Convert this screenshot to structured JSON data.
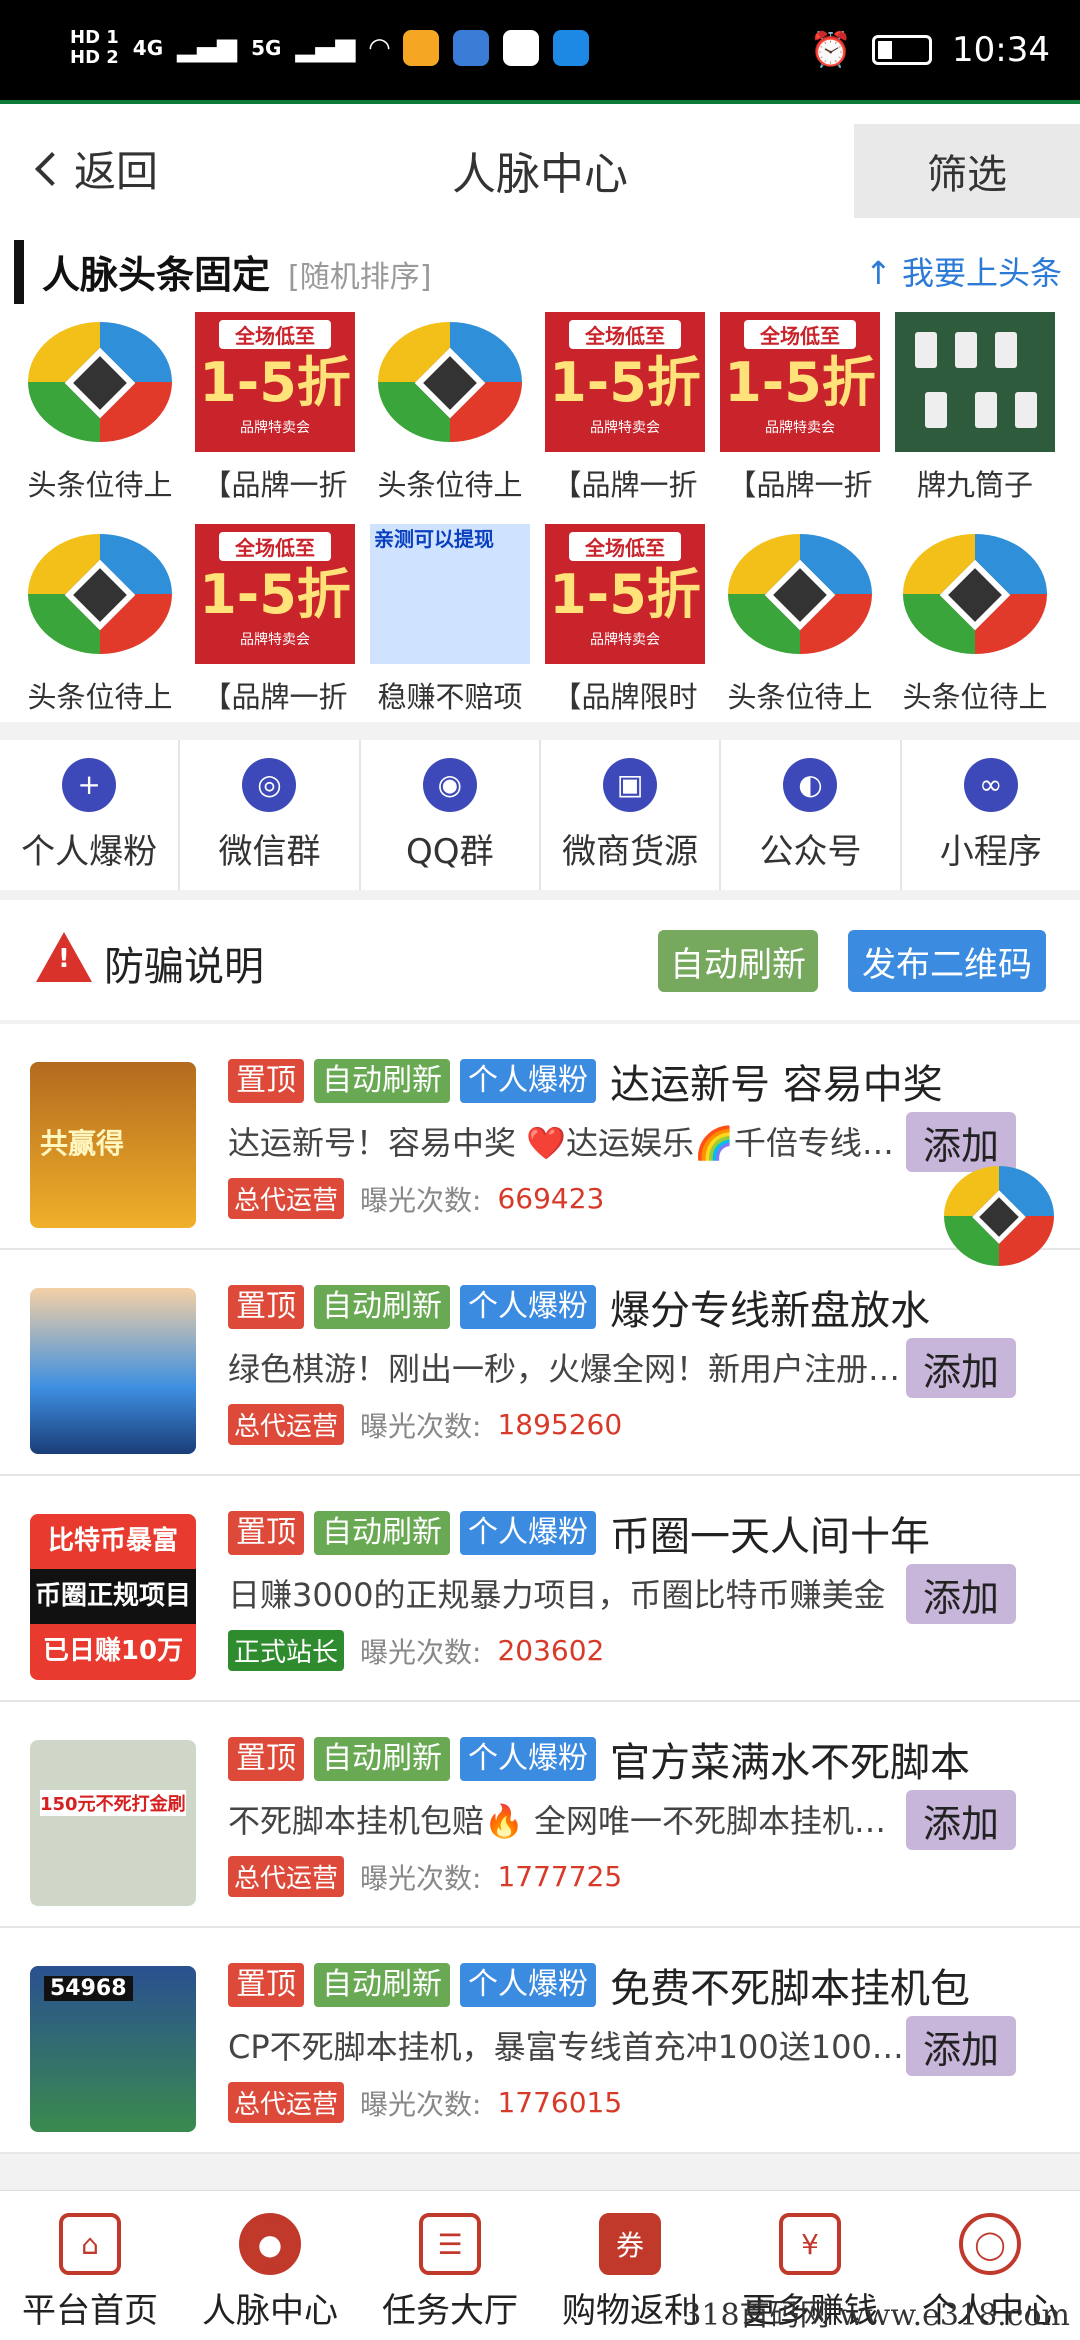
{
  "status_bar": {
    "time": "10:34",
    "hd1": "HD 1",
    "hd2": "HD 2",
    "net1": "4G",
    "net2": "5G"
  },
  "header": {
    "back_label": "返回",
    "title": "人脉中心",
    "filter_label": "筛选"
  },
  "headline": {
    "title": "人脉头条固定",
    "subtitle": "[随机排序]",
    "link": "↑ 我要上头条",
    "sale_text_top": "全场低至",
    "sale_text_big": "1-5折",
    "sale_text_bottom": "品牌特卖会",
    "text_ad_line": "亲测可以提现",
    "items": [
      {
        "label": "头条位待上",
        "thumb": "logo"
      },
      {
        "label": "【品牌一折",
        "thumb": "sale"
      },
      {
        "label": "头条位待上",
        "thumb": "logo"
      },
      {
        "label": "【品牌一折",
        "thumb": "sale"
      },
      {
        "label": "【品牌一折",
        "thumb": "sale"
      },
      {
        "label": "牌九筒子",
        "thumb": "game"
      },
      {
        "label": "头条位待上",
        "thumb": "logo"
      },
      {
        "label": "【品牌一折",
        "thumb": "sale"
      },
      {
        "label": "稳赚不赔项",
        "thumb": "text"
      },
      {
        "label": "【品牌限时",
        "thumb": "sale"
      },
      {
        "label": "头条位待上",
        "thumb": "logo"
      },
      {
        "label": "头条位待上",
        "thumb": "logo"
      }
    ]
  },
  "categories": [
    {
      "label": "个人爆粉",
      "icon": "user-add-icon"
    },
    {
      "label": "微信群",
      "icon": "wechat-icon"
    },
    {
      "label": "QQ群",
      "icon": "qq-icon"
    },
    {
      "label": "微商货源",
      "icon": "cart-icon"
    },
    {
      "label": "公众号",
      "icon": "official-account-icon"
    },
    {
      "label": "小程序",
      "icon": "mini-program-icon"
    }
  ],
  "notice": {
    "label": "防骗说明",
    "auto_refresh": "自动刷新",
    "publish_qr": "发布二维码"
  },
  "listings": [
    {
      "tag_top": "置顶",
      "tag_auto": "自动刷新",
      "tag_cat": "个人爆粉",
      "title": "达运新号 容易中奖",
      "desc": "达运新号！容易中奖 ❤️达运娱乐🌈千倍专线…",
      "badge": "总代运营",
      "badge_color": "red",
      "views_label": "曝光次数:",
      "views": "669423",
      "add": "添加",
      "thumb_text": "共赢得"
    },
    {
      "tag_top": "置顶",
      "tag_auto": "自动刷新",
      "tag_cat": "个人爆粉",
      "title": "爆分专线新盘放水",
      "desc": "绿色棋游！刚出一秒，火爆全网！新用户注册…",
      "badge": "总代运营",
      "badge_color": "red",
      "views_label": "曝光次数:",
      "views": "1895260",
      "add": "添加",
      "thumb_text": ""
    },
    {
      "tag_top": "置顶",
      "tag_auto": "自动刷新",
      "tag_cat": "个人爆粉",
      "title": "币圈一天人间十年",
      "desc": "日赚3000的正规暴力项目，币圈比特币赚美金",
      "badge": "正式站长",
      "badge_color": "green",
      "views_label": "曝光次数:",
      "views": "203602",
      "add": "添加",
      "thumb_lines": [
        "比特币暴富",
        "币圈正规项目",
        "已日赚10万"
      ]
    },
    {
      "tag_top": "置顶",
      "tag_auto": "自动刷新",
      "tag_cat": "个人爆粉",
      "title": "官方菜满水不死脚本",
      "desc": "不死脚本挂机包赔🔥 全网唯一不死脚本挂机…",
      "badge": "总代运营",
      "badge_color": "red",
      "views_label": "曝光次数:",
      "views": "1777725",
      "add": "添加",
      "thumb_text": "150元不死打金刷"
    },
    {
      "tag_top": "置顶",
      "tag_auto": "自动刷新",
      "tag_cat": "个人爆粉",
      "title": "免费不死脚本挂机包",
      "desc": "CP不死脚本挂机，暴富专线首充冲100送100…",
      "badge": "总代运营",
      "badge_color": "red",
      "views_label": "曝光次数:",
      "views": "1776015",
      "add": "添加",
      "thumb_text": "54968"
    }
  ],
  "bottom_nav": [
    {
      "label": "平台首页",
      "icon": "home-icon"
    },
    {
      "label": "人脉中心",
      "icon": "people-icon"
    },
    {
      "label": "任务大厅",
      "icon": "task-icon"
    },
    {
      "label": "购物返利",
      "icon": "shopping-cart-icon"
    },
    {
      "label": "更多赚钱",
      "icon": "wallet-icon"
    },
    {
      "label": "个人中心",
      "icon": "profile-icon"
    }
  ],
  "watermark": "318首码网 www.e318.com"
}
